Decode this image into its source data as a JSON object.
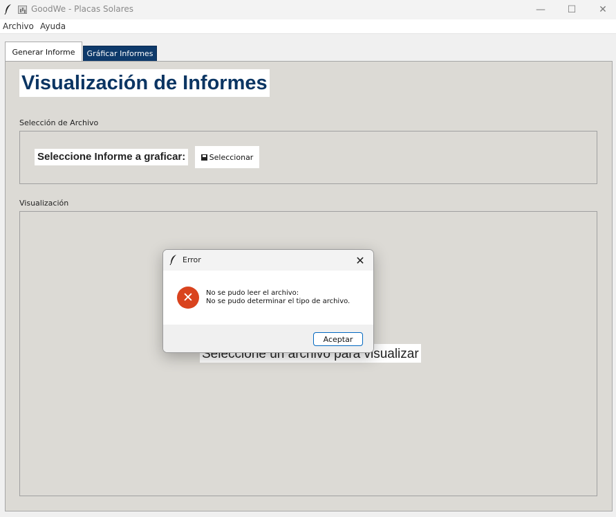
{
  "window": {
    "title": "GoodWe - Placas Solares",
    "minimize_glyph": "—",
    "maximize_glyph": "☐",
    "close_glyph": "✕"
  },
  "menu": {
    "items": [
      "Archivo",
      "Ayuda"
    ]
  },
  "tabs": [
    {
      "label": "Generar Informe"
    },
    {
      "label": "Gráficar Informes"
    }
  ],
  "page": {
    "heading": "Visualización de Informes",
    "file_section_label": "Selección de Archivo",
    "select_label": "Seleccione Informe a graficar:",
    "select_button": "Seleccionar",
    "visual_section_label": "Visualización",
    "placeholder": "Seleccione un archivo para visualizar"
  },
  "dialog": {
    "title": "Error",
    "close_glyph": "✕",
    "error_glyph": "✕",
    "message_line1": "No se pudo leer el archivo:",
    "message_line2": "No se pudo determinar el tipo de archivo.",
    "ok_button": "Aceptar"
  },
  "colors": {
    "accent_tab": "#0e3a6b",
    "heading": "#0b3563",
    "panel_bg": "#dcdad5",
    "error_icon": "#d9431e"
  },
  "icons": {
    "app": "feather-icon",
    "title_small": "chart-icon",
    "select_button": "floppy-icon",
    "dialog": "feather-icon",
    "dialog_error": "error-circle-icon"
  }
}
